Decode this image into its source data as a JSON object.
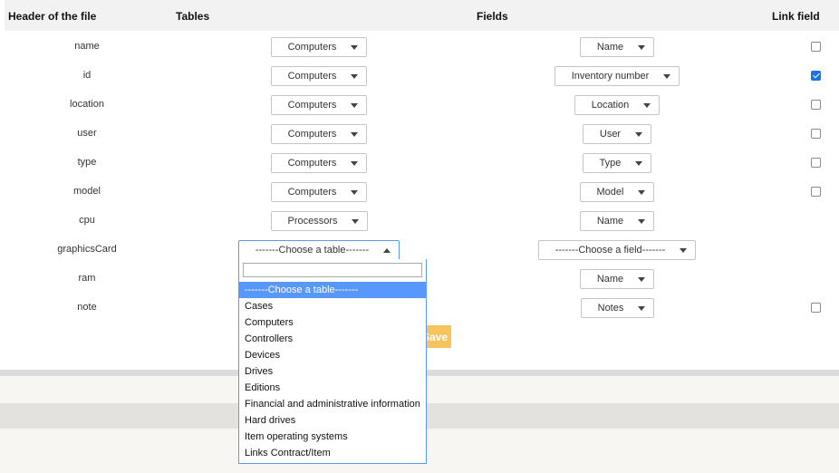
{
  "headers": {
    "file": "Header of the file",
    "tables": "Tables",
    "fields": "Fields",
    "link": "Link field"
  },
  "rows": [
    {
      "label": "name",
      "table": "Computers",
      "field": "Name",
      "link": false
    },
    {
      "label": "id",
      "table": "Computers",
      "field": "Inventory number",
      "link": true
    },
    {
      "label": "location",
      "table": "Computers",
      "field": "Location",
      "link": false
    },
    {
      "label": "user",
      "table": "Computers",
      "field": "User",
      "link": false
    },
    {
      "label": "type",
      "table": "Computers",
      "field": "Type",
      "link": false
    },
    {
      "label": "model",
      "table": "Computers",
      "field": "Model",
      "link": false
    },
    {
      "label": "cpu",
      "table": "Processors",
      "field": "Name"
    },
    {
      "label": "graphicsCard",
      "table": "-------Choose a table-------",
      "field": "-------Choose a field-------"
    },
    {
      "label": "ram",
      "field": "Name"
    },
    {
      "label": "note",
      "field": "Notes",
      "link": false
    }
  ],
  "save_label": "Save",
  "dropdown": {
    "search_value": "",
    "items": [
      "-------Choose a table-------",
      "Cases",
      "Computers",
      "Controllers",
      "Devices",
      "Drives",
      "Editions",
      "Financial and administrative information",
      "Hard drives",
      "Item operating systems",
      "Links Contract/Item"
    ],
    "highlighted": "-------Choose a table-------"
  }
}
